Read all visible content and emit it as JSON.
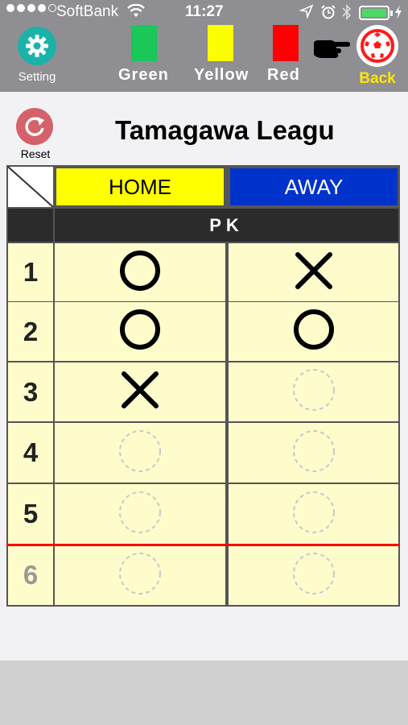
{
  "status_bar": {
    "carrier": "SoftBank",
    "time": "11:27",
    "signal_bars": 4,
    "signal_total": 5,
    "battery_level": 1.0
  },
  "toolbar": {
    "setting_label": "Setting",
    "cards": [
      {
        "label": "Green",
        "color": "#1ac757"
      },
      {
        "label": "Yellow",
        "color": "#fcff00"
      },
      {
        "label": "Red",
        "color": "#fe0000"
      }
    ],
    "back_label": "Back"
  },
  "page": {
    "title": "Tamagawa Leagu",
    "reset_label": "Reset"
  },
  "table": {
    "home_label": "HOME",
    "away_label": "AWAY",
    "section_label": "PK",
    "rows": [
      {
        "num": "1",
        "home": "O",
        "away": "X"
      },
      {
        "num": "2",
        "home": "O",
        "away": "O"
      },
      {
        "num": "3",
        "home": "X",
        "away": ""
      },
      {
        "num": "4",
        "home": "",
        "away": ""
      },
      {
        "num": "5",
        "home": "",
        "away": ""
      },
      {
        "num": "6",
        "home": "",
        "away": ""
      }
    ]
  }
}
